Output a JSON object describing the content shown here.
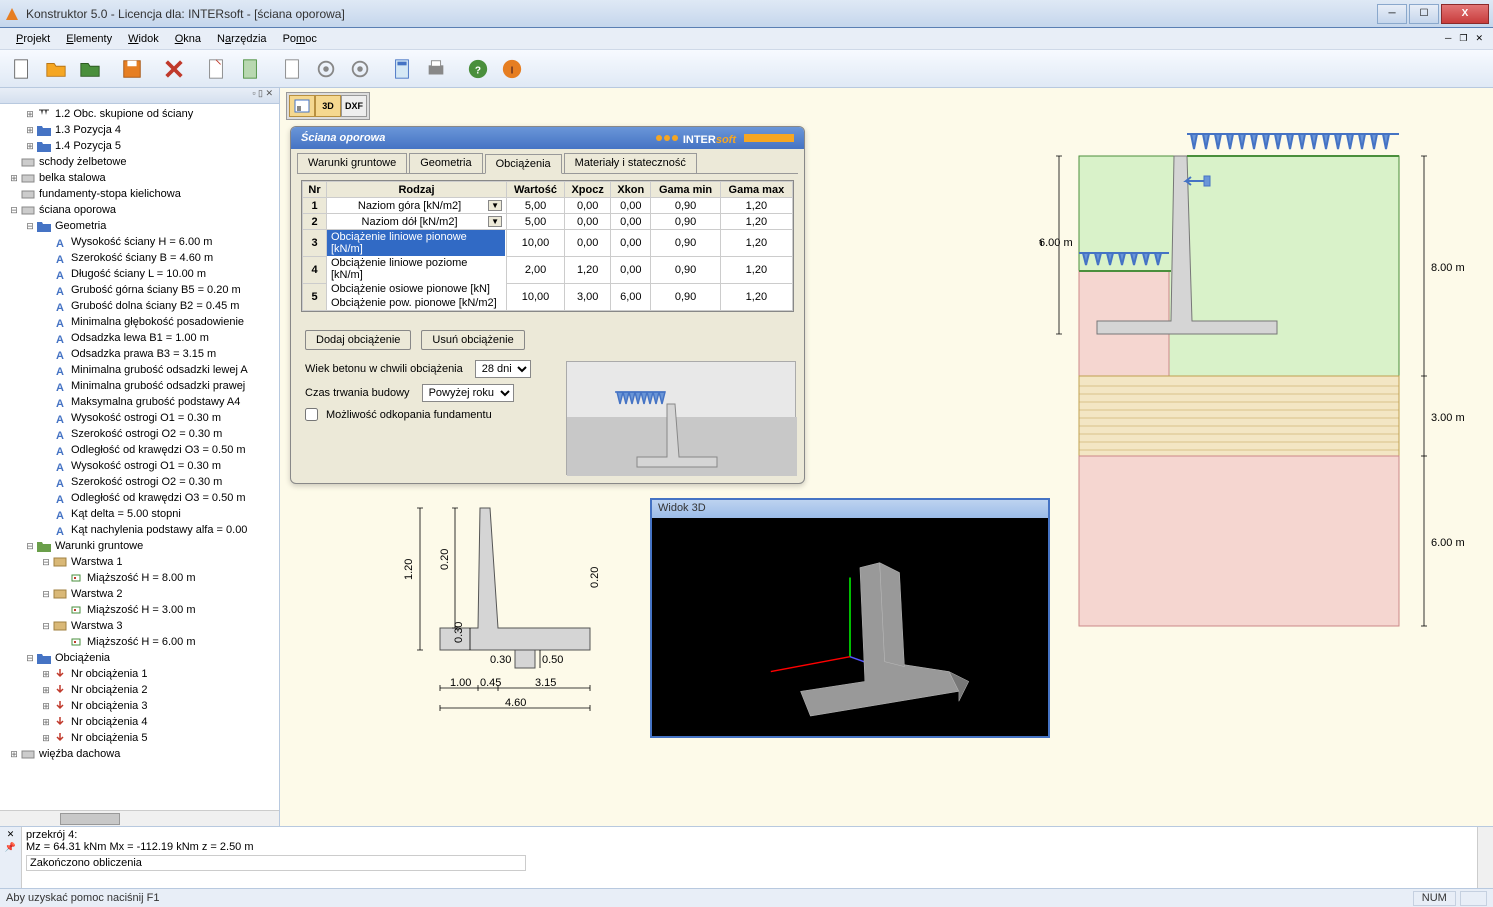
{
  "window": {
    "title": "Konstruktor 5.0 - Licencja dla: INTERsoft - [ściana oporowa]"
  },
  "menu": {
    "items": [
      "Projekt",
      "Elementy",
      "Widok",
      "Okna",
      "Narzędzia",
      "Pomoc"
    ]
  },
  "viewbuttons": {
    "b2d": "",
    "b3d": "3D",
    "dxf": "DXF"
  },
  "tree": {
    "rows": [
      {
        "ind": 1,
        "exp": "+",
        "ico": "load",
        "label": "1.2 Obc. skupione od ściany"
      },
      {
        "ind": 1,
        "exp": "+",
        "ico": "folder-blue",
        "label": "1.3 Pozycja 4"
      },
      {
        "ind": 1,
        "exp": "+",
        "ico": "folder-blue",
        "label": "1.4 Pozycja 5"
      },
      {
        "ind": 0,
        "exp": "",
        "ico": "module",
        "label": "schody żelbetowe"
      },
      {
        "ind": 0,
        "exp": "+",
        "ico": "module",
        "label": "belka stalowa"
      },
      {
        "ind": 0,
        "exp": "",
        "ico": "module",
        "label": "fundamenty-stopa kielichowa"
      },
      {
        "ind": 0,
        "exp": "-",
        "ico": "module",
        "label": "ściana oporowa"
      },
      {
        "ind": 1,
        "exp": "-",
        "ico": "folder-blue",
        "label": "Geometria"
      },
      {
        "ind": 2,
        "exp": "",
        "ico": "A",
        "label": "Wysokość ściany H = 6.00 m"
      },
      {
        "ind": 2,
        "exp": "",
        "ico": "A",
        "label": "Szerokość ściany B = 4.60 m"
      },
      {
        "ind": 2,
        "exp": "",
        "ico": "A",
        "label": "Długość ściany L = 10.00 m"
      },
      {
        "ind": 2,
        "exp": "",
        "ico": "A",
        "label": "Grubość górna ściany B5 = 0.20 m"
      },
      {
        "ind": 2,
        "exp": "",
        "ico": "A",
        "label": "Grubość dolna ściany B2 = 0.45 m"
      },
      {
        "ind": 2,
        "exp": "",
        "ico": "A",
        "label": "Minimalna głębokość posadowienie"
      },
      {
        "ind": 2,
        "exp": "",
        "ico": "A",
        "label": "Odsadzka lewa B1 = 1.00 m"
      },
      {
        "ind": 2,
        "exp": "",
        "ico": "A",
        "label": "Odsadzka prawa B3 = 3.15 m"
      },
      {
        "ind": 2,
        "exp": "",
        "ico": "A",
        "label": "Minimalna grubość odsadzki lewej A"
      },
      {
        "ind": 2,
        "exp": "",
        "ico": "A",
        "label": "Minimalna grubość odsadzki prawej"
      },
      {
        "ind": 2,
        "exp": "",
        "ico": "A",
        "label": "Maksymalna grubość podstawy A4"
      },
      {
        "ind": 2,
        "exp": "",
        "ico": "A",
        "label": "Wysokość ostrogi O1 = 0.30 m"
      },
      {
        "ind": 2,
        "exp": "",
        "ico": "A",
        "label": "Szerokość ostrogi O2 = 0.30 m"
      },
      {
        "ind": 2,
        "exp": "",
        "ico": "A",
        "label": "Odległość od krawędzi O3 = 0.50 m"
      },
      {
        "ind": 2,
        "exp": "",
        "ico": "A",
        "label": "Wysokość ostrogi O1 = 0.30 m"
      },
      {
        "ind": 2,
        "exp": "",
        "ico": "A",
        "label": "Szerokość ostrogi O2 = 0.30 m"
      },
      {
        "ind": 2,
        "exp": "",
        "ico": "A",
        "label": "Odległość od krawędzi O3 = 0.50 m"
      },
      {
        "ind": 2,
        "exp": "",
        "ico": "A",
        "label": "Kąt delta = 5.00 stopni"
      },
      {
        "ind": 2,
        "exp": "",
        "ico": "A",
        "label": "Kąt nachylenia podstawy alfa = 0.00"
      },
      {
        "ind": 1,
        "exp": "-",
        "ico": "folder-green",
        "label": "Warunki gruntowe"
      },
      {
        "ind": 2,
        "exp": "-",
        "ico": "layer",
        "label": "Warstwa 1"
      },
      {
        "ind": 3,
        "exp": "",
        "ico": "px",
        "label": "Miąższość H = 8.00 m"
      },
      {
        "ind": 2,
        "exp": "-",
        "ico": "layer",
        "label": "Warstwa 2"
      },
      {
        "ind": 3,
        "exp": "",
        "ico": "px",
        "label": "Miąższość H = 3.00 m"
      },
      {
        "ind": 2,
        "exp": "-",
        "ico": "layer",
        "label": "Warstwa 3"
      },
      {
        "ind": 3,
        "exp": "",
        "ico": "px",
        "label": "Miąższość H = 6.00 m"
      },
      {
        "ind": 1,
        "exp": "-",
        "ico": "folder-blue",
        "label": "Obciążenia"
      },
      {
        "ind": 2,
        "exp": "+",
        "ico": "force",
        "label": "Nr obciążenia 1"
      },
      {
        "ind": 2,
        "exp": "+",
        "ico": "force",
        "label": "Nr obciążenia 2"
      },
      {
        "ind": 2,
        "exp": "+",
        "ico": "force",
        "label": "Nr obciążenia 3"
      },
      {
        "ind": 2,
        "exp": "+",
        "ico": "force",
        "label": "Nr obciążenia 4"
      },
      {
        "ind": 2,
        "exp": "+",
        "ico": "force",
        "label": "Nr obciążenia 5"
      },
      {
        "ind": 0,
        "exp": "+",
        "ico": "module",
        "label": "więźba dachowa"
      }
    ]
  },
  "dialog": {
    "title": "Ściana oporowa",
    "brand": "INTERsoft",
    "tabs": [
      "Warunki gruntowe",
      "Geometria",
      "Obciążenia",
      "Materiały i stateczność"
    ],
    "active_tab": 2,
    "grid": {
      "headers": [
        "Nr",
        "Rodzaj",
        "Wartość",
        "Xpocz",
        "Xkon",
        "Gama min",
        "Gama max"
      ],
      "rows": [
        {
          "nr": "1",
          "rodzaj": "Naziom góra [kN/m2]",
          "w": "5,00",
          "xp": "0,00",
          "xk": "0,00",
          "gmin": "0,90",
          "gmax": "1,20",
          "dd": true
        },
        {
          "nr": "2",
          "rodzaj": "Naziom dół [kN/m2]",
          "w": "5,00",
          "xp": "0,00",
          "xk": "0,00",
          "gmin": "0,90",
          "gmax": "1,20",
          "dd": true
        },
        {
          "nr": "3",
          "rodzaj": "",
          "w": "10,00",
          "xp": "0,00",
          "xk": "0,00",
          "gmin": "0,90",
          "gmax": "1,20"
        },
        {
          "nr": "4",
          "rodzaj": "",
          "w": "2,00",
          "xp": "1,20",
          "xk": "0,00",
          "gmin": "0,90",
          "gmax": "1,20"
        },
        {
          "nr": "5",
          "rodzaj": "",
          "w": "10,00",
          "xp": "3,00",
          "xk": "6,00",
          "gmin": "0,90",
          "gmax": "1,20"
        }
      ],
      "dropdown_options": [
        "Obciążenie liniowe pionowe [kN/m]",
        "Obciążenie liniowe poziome [kN/m]",
        "Obciążenie osiowe pionowe [kN]",
        "Obciążenie pow. pionowe [kN/m2]"
      ],
      "dropdown_selected": 0
    },
    "btn_add": "Dodaj obciążenie",
    "btn_del": "Usuń obciążenie",
    "label_wiek": "Wiek betonu w chwili obciążenia",
    "sel_wiek": "28 dni",
    "label_czas": "Czas trwania budowy",
    "sel_czas": "Powyżej roku",
    "chk_odkop": "Możliwość odkopania fundamentu"
  },
  "widok3d": {
    "title": "Widok 3D"
  },
  "section": {
    "dims": {
      "d120": "1.20",
      "d020": "0.20",
      "d030": "0.30",
      "d030b": "0.30",
      "d050": "0.50",
      "d020b": "0.20",
      "d100": "1.00",
      "d045": "0.45",
      "d315": "3.15",
      "d460": "4.60"
    }
  },
  "bigdiag": {
    "d600": "6.00 m",
    "d800": "8.00 m",
    "d300": "3.00 m",
    "d600b": "6.00 m"
  },
  "bottom": {
    "line1": "przekrój 4:",
    "line2": "Mz = 64.31 kNm   Mx = -112.19 kNm  z = 2.50 m",
    "input": "Zakończono obliczenia"
  },
  "status": {
    "help": "Aby uzyskać pomoc naciśnij F1",
    "num": "NUM"
  }
}
